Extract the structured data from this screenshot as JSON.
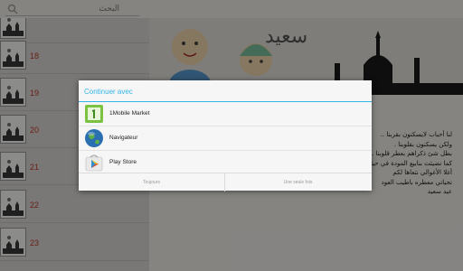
{
  "search": {
    "placeholder": "البحث"
  },
  "list": {
    "rows": [
      {
        "number": ""
      },
      {
        "number": "18"
      },
      {
        "number": "19"
      },
      {
        "number": "20"
      },
      {
        "number": "21"
      },
      {
        "number": "22"
      },
      {
        "number": "23"
      }
    ]
  },
  "article": {
    "banner_caption": "سعيد",
    "lines": [
      "لنا أحباب لايسكنون بقربنا ..",
      "ولكن يسكنون بقلوبنا .",
      "بطل شئ ذكراهم بعطر قلوبنا .",
      "كما نضيئت بنابيع المودة في حياتنا .",
      "أغلا الأغوالي نتعاها لكم",
      "تحياتي معطره باطيب العود",
      "عيد سعيد"
    ]
  },
  "dialog": {
    "title": "Continuer avec",
    "apps": [
      {
        "label": "1Mobile Market",
        "icon": "1mobile-market-icon"
      },
      {
        "label": "Navigateur",
        "icon": "globe-icon"
      },
      {
        "label": "Play Store",
        "icon": "play-store-icon"
      }
    ],
    "btn_always": "Toujours",
    "btn_once": "Une seule fois"
  },
  "colors": {
    "accent": "#33b5e5",
    "row_number": "#c0392b"
  }
}
